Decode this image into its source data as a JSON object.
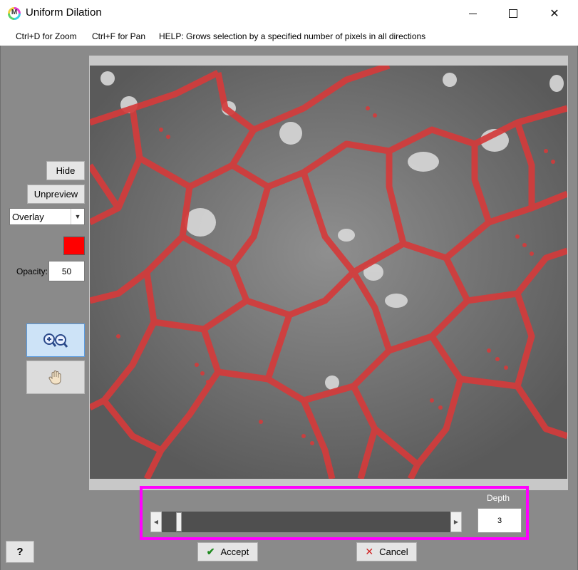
{
  "window": {
    "title": "Uniform Dilation"
  },
  "app_icon_letter": "M",
  "menu": {
    "zoom_hint": "Ctrl+D for Zoom",
    "pan_hint": "Ctrl+F for Pan",
    "help": "HELP:  Grows selection by a specified number of pixels in all directions"
  },
  "controls": {
    "hide_label": "Hide",
    "unpreview_label": "Unpreview",
    "overlay_mode": "Overlay",
    "overlay_color": "#ff0000",
    "opacity_label": "Opacity:",
    "opacity_value": "50"
  },
  "tools": {
    "zoom_icon": "zoom-in-out-icon",
    "pan_icon": "hand-pan-icon"
  },
  "depth": {
    "label": "Depth",
    "value": "3",
    "slider_fraction": 0.05
  },
  "footer": {
    "help_label": "?",
    "accept_label": "Accept",
    "cancel_label": "Cancel"
  },
  "colors": {
    "accent_highlight": "#ff00ff",
    "overlay_red": "#e03030"
  }
}
